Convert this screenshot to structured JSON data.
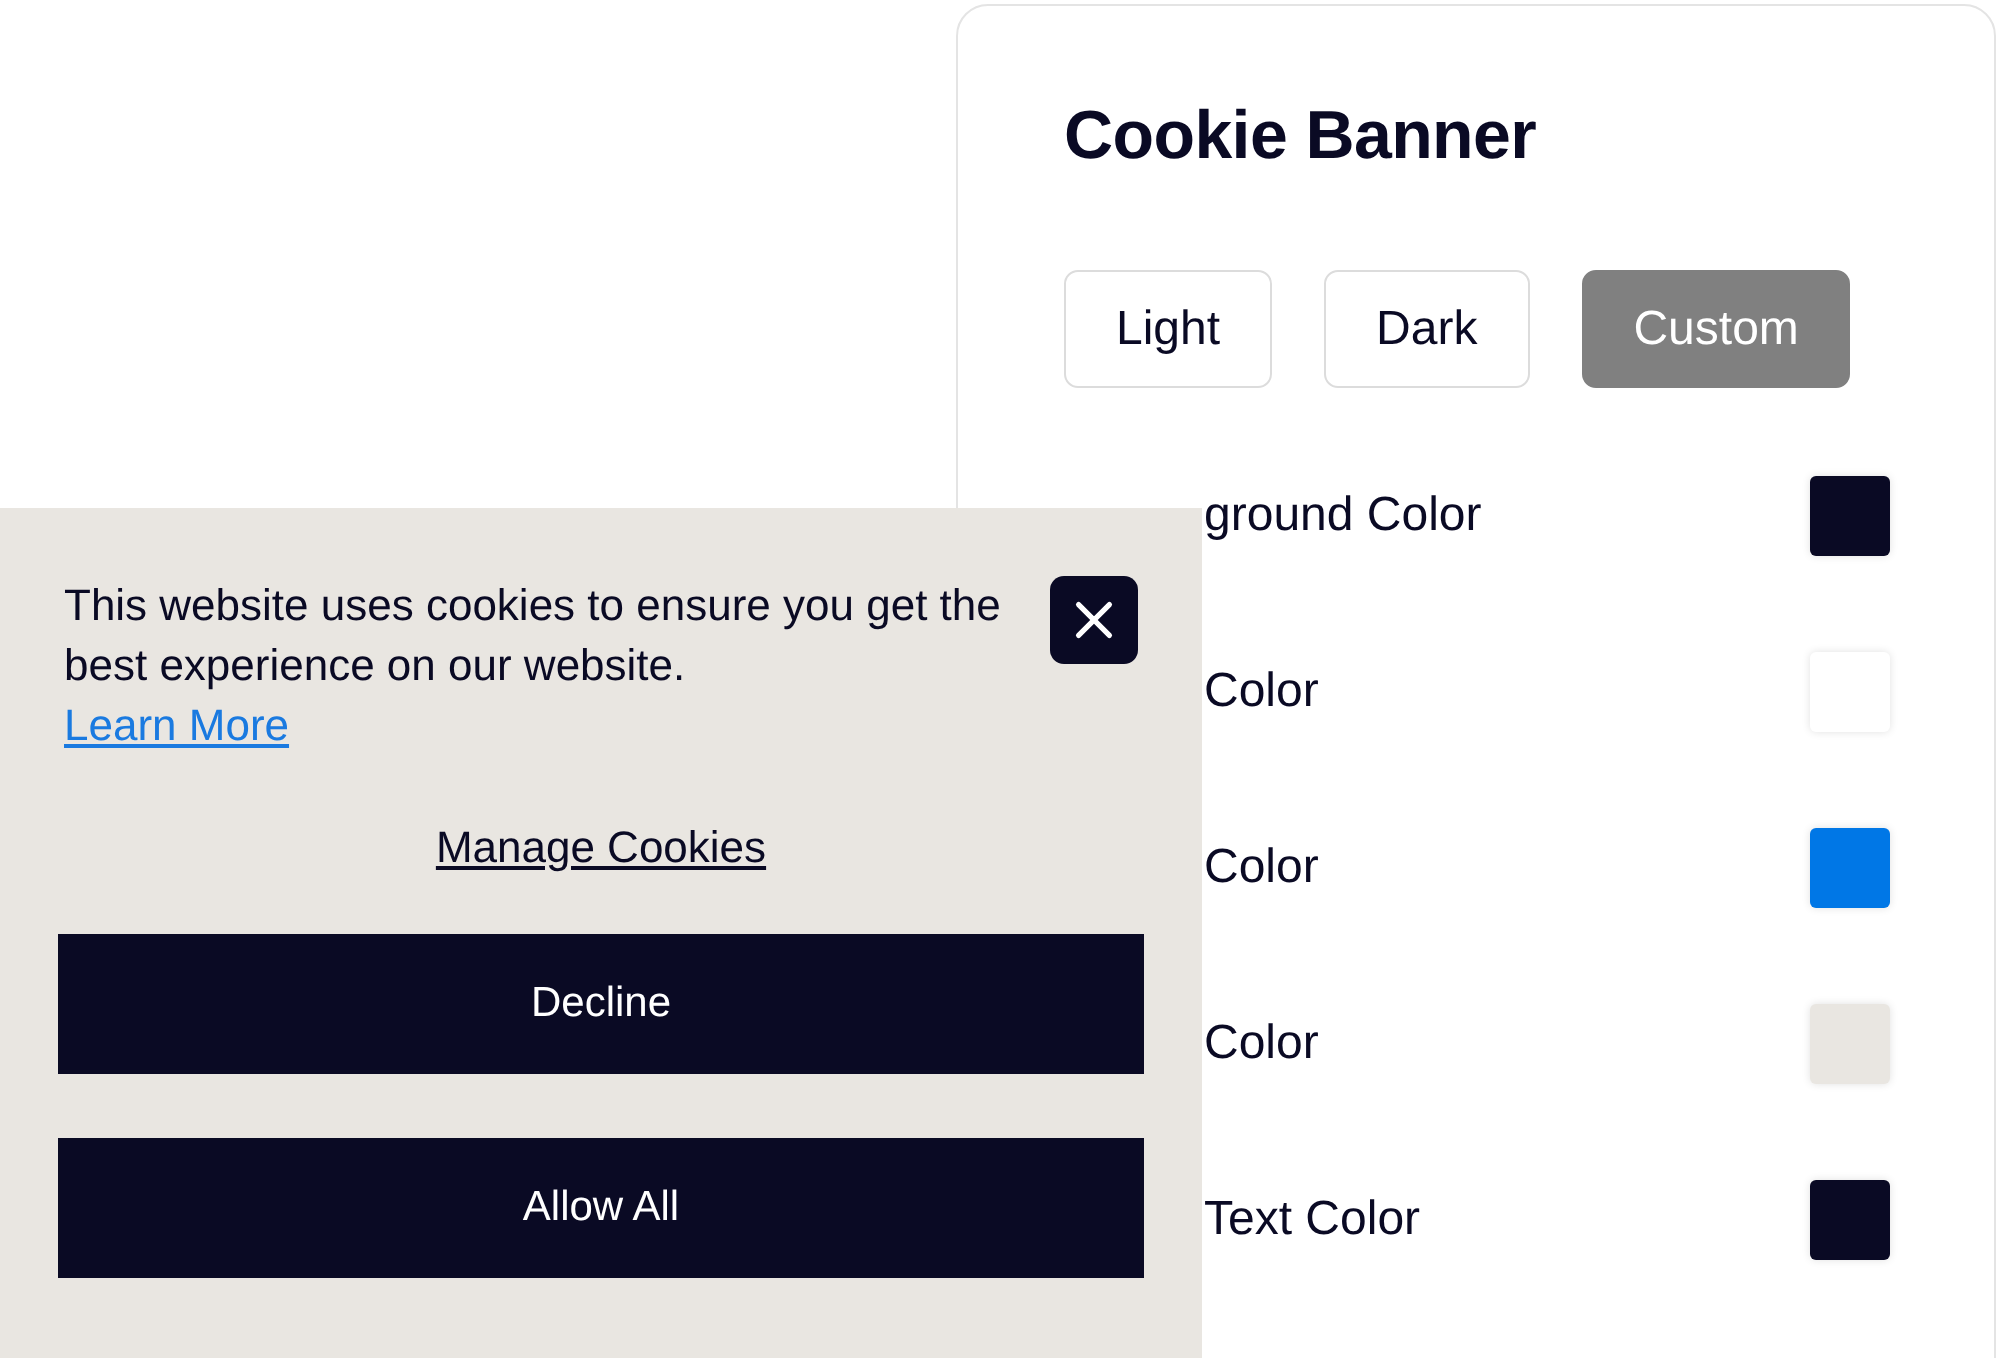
{
  "settings_panel": {
    "title": "Cookie Banner",
    "themes": [
      {
        "label": "Light",
        "selected": false
      },
      {
        "label": "Dark",
        "selected": false
      },
      {
        "label": "Custom",
        "selected": true
      }
    ],
    "colors": [
      {
        "label": "ground Color",
        "color": "#0a0a24"
      },
      {
        "label": "Color",
        "color": "#ffffff"
      },
      {
        "label": "Color",
        "color": "#0077e6"
      },
      {
        "label": "Color",
        "color": "#e9e6e1"
      },
      {
        "label": "Text Color",
        "color": "#0a0a24"
      }
    ]
  },
  "cookie_banner": {
    "message": "This website uses cookies to ensure you get the best experience on our website.",
    "learn_more": "Learn More",
    "manage": "Manage Cookies",
    "buttons": [
      "Decline",
      "Allow All"
    ]
  }
}
